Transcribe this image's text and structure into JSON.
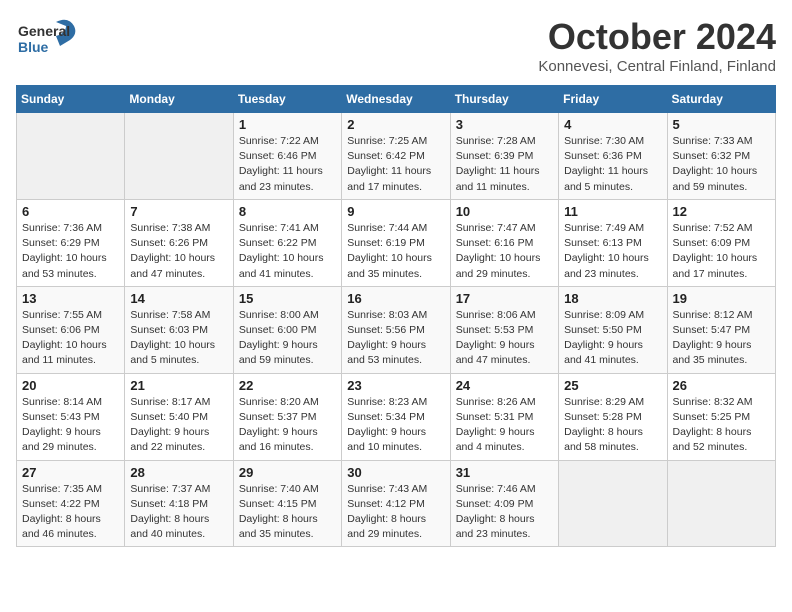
{
  "header": {
    "logo_general": "General",
    "logo_blue": "Blue",
    "month": "October 2024",
    "location": "Konnevesi, Central Finland, Finland"
  },
  "weekdays": [
    "Sunday",
    "Monday",
    "Tuesday",
    "Wednesday",
    "Thursday",
    "Friday",
    "Saturday"
  ],
  "weeks": [
    [
      {
        "day": "",
        "sunrise": "",
        "sunset": "",
        "daylight": "",
        "empty": true
      },
      {
        "day": "",
        "sunrise": "",
        "sunset": "",
        "daylight": "",
        "empty": true
      },
      {
        "day": "1",
        "sunrise": "Sunrise: 7:22 AM",
        "sunset": "Sunset: 6:46 PM",
        "daylight": "Daylight: 11 hours and 23 minutes."
      },
      {
        "day": "2",
        "sunrise": "Sunrise: 7:25 AM",
        "sunset": "Sunset: 6:42 PM",
        "daylight": "Daylight: 11 hours and 17 minutes."
      },
      {
        "day": "3",
        "sunrise": "Sunrise: 7:28 AM",
        "sunset": "Sunset: 6:39 PM",
        "daylight": "Daylight: 11 hours and 11 minutes."
      },
      {
        "day": "4",
        "sunrise": "Sunrise: 7:30 AM",
        "sunset": "Sunset: 6:36 PM",
        "daylight": "Daylight: 11 hours and 5 minutes."
      },
      {
        "day": "5",
        "sunrise": "Sunrise: 7:33 AM",
        "sunset": "Sunset: 6:32 PM",
        "daylight": "Daylight: 10 hours and 59 minutes."
      }
    ],
    [
      {
        "day": "6",
        "sunrise": "Sunrise: 7:36 AM",
        "sunset": "Sunset: 6:29 PM",
        "daylight": "Daylight: 10 hours and 53 minutes."
      },
      {
        "day": "7",
        "sunrise": "Sunrise: 7:38 AM",
        "sunset": "Sunset: 6:26 PM",
        "daylight": "Daylight: 10 hours and 47 minutes."
      },
      {
        "day": "8",
        "sunrise": "Sunrise: 7:41 AM",
        "sunset": "Sunset: 6:22 PM",
        "daylight": "Daylight: 10 hours and 41 minutes."
      },
      {
        "day": "9",
        "sunrise": "Sunrise: 7:44 AM",
        "sunset": "Sunset: 6:19 PM",
        "daylight": "Daylight: 10 hours and 35 minutes."
      },
      {
        "day": "10",
        "sunrise": "Sunrise: 7:47 AM",
        "sunset": "Sunset: 6:16 PM",
        "daylight": "Daylight: 10 hours and 29 minutes."
      },
      {
        "day": "11",
        "sunrise": "Sunrise: 7:49 AM",
        "sunset": "Sunset: 6:13 PM",
        "daylight": "Daylight: 10 hours and 23 minutes."
      },
      {
        "day": "12",
        "sunrise": "Sunrise: 7:52 AM",
        "sunset": "Sunset: 6:09 PM",
        "daylight": "Daylight: 10 hours and 17 minutes."
      }
    ],
    [
      {
        "day": "13",
        "sunrise": "Sunrise: 7:55 AM",
        "sunset": "Sunset: 6:06 PM",
        "daylight": "Daylight: 10 hours and 11 minutes."
      },
      {
        "day": "14",
        "sunrise": "Sunrise: 7:58 AM",
        "sunset": "Sunset: 6:03 PM",
        "daylight": "Daylight: 10 hours and 5 minutes."
      },
      {
        "day": "15",
        "sunrise": "Sunrise: 8:00 AM",
        "sunset": "Sunset: 6:00 PM",
        "daylight": "Daylight: 9 hours and 59 minutes."
      },
      {
        "day": "16",
        "sunrise": "Sunrise: 8:03 AM",
        "sunset": "Sunset: 5:56 PM",
        "daylight": "Daylight: 9 hours and 53 minutes."
      },
      {
        "day": "17",
        "sunrise": "Sunrise: 8:06 AM",
        "sunset": "Sunset: 5:53 PM",
        "daylight": "Daylight: 9 hours and 47 minutes."
      },
      {
        "day": "18",
        "sunrise": "Sunrise: 8:09 AM",
        "sunset": "Sunset: 5:50 PM",
        "daylight": "Daylight: 9 hours and 41 minutes."
      },
      {
        "day": "19",
        "sunrise": "Sunrise: 8:12 AM",
        "sunset": "Sunset: 5:47 PM",
        "daylight": "Daylight: 9 hours and 35 minutes."
      }
    ],
    [
      {
        "day": "20",
        "sunrise": "Sunrise: 8:14 AM",
        "sunset": "Sunset: 5:43 PM",
        "daylight": "Daylight: 9 hours and 29 minutes."
      },
      {
        "day": "21",
        "sunrise": "Sunrise: 8:17 AM",
        "sunset": "Sunset: 5:40 PM",
        "daylight": "Daylight: 9 hours and 22 minutes."
      },
      {
        "day": "22",
        "sunrise": "Sunrise: 8:20 AM",
        "sunset": "Sunset: 5:37 PM",
        "daylight": "Daylight: 9 hours and 16 minutes."
      },
      {
        "day": "23",
        "sunrise": "Sunrise: 8:23 AM",
        "sunset": "Sunset: 5:34 PM",
        "daylight": "Daylight: 9 hours and 10 minutes."
      },
      {
        "day": "24",
        "sunrise": "Sunrise: 8:26 AM",
        "sunset": "Sunset: 5:31 PM",
        "daylight": "Daylight: 9 hours and 4 minutes."
      },
      {
        "day": "25",
        "sunrise": "Sunrise: 8:29 AM",
        "sunset": "Sunset: 5:28 PM",
        "daylight": "Daylight: 8 hours and 58 minutes."
      },
      {
        "day": "26",
        "sunrise": "Sunrise: 8:32 AM",
        "sunset": "Sunset: 5:25 PM",
        "daylight": "Daylight: 8 hours and 52 minutes."
      }
    ],
    [
      {
        "day": "27",
        "sunrise": "Sunrise: 7:35 AM",
        "sunset": "Sunset: 4:22 PM",
        "daylight": "Daylight: 8 hours and 46 minutes."
      },
      {
        "day": "28",
        "sunrise": "Sunrise: 7:37 AM",
        "sunset": "Sunset: 4:18 PM",
        "daylight": "Daylight: 8 hours and 40 minutes."
      },
      {
        "day": "29",
        "sunrise": "Sunrise: 7:40 AM",
        "sunset": "Sunset: 4:15 PM",
        "daylight": "Daylight: 8 hours and 35 minutes."
      },
      {
        "day": "30",
        "sunrise": "Sunrise: 7:43 AM",
        "sunset": "Sunset: 4:12 PM",
        "daylight": "Daylight: 8 hours and 29 minutes."
      },
      {
        "day": "31",
        "sunrise": "Sunrise: 7:46 AM",
        "sunset": "Sunset: 4:09 PM",
        "daylight": "Daylight: 8 hours and 23 minutes."
      },
      {
        "day": "",
        "sunrise": "",
        "sunset": "",
        "daylight": "",
        "empty": true
      },
      {
        "day": "",
        "sunrise": "",
        "sunset": "",
        "daylight": "",
        "empty": true
      }
    ]
  ]
}
